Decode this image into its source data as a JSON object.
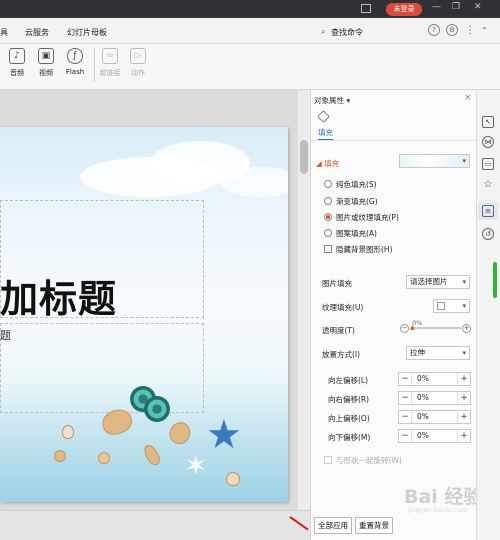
{
  "titlebar": {
    "login_badge": "未登录"
  },
  "menubar": {
    "items": [
      "具",
      "云服务",
      "幻灯片母板"
    ],
    "search_label": "查找命令"
  },
  "ribbon": {
    "buttons": [
      "音频",
      "视频",
      "Flash",
      "超链接",
      "动作"
    ],
    "icons": {
      "audio": "speaker-icon",
      "video": "film-icon",
      "flash": "flash-icon",
      "hyperlink": "link-icon",
      "action": "play-icon"
    }
  },
  "slide": {
    "title_text": "加标题",
    "subtitle_text": "题"
  },
  "panel": {
    "title": "对象属性",
    "title_caret": "▾",
    "close": "×",
    "tab_fill": "填充",
    "fill_section": "填充",
    "fill_options": [
      "纯色填充(S)",
      "渐变填充(G)",
      "图片或纹理填充(P)",
      "图案填充(A)"
    ],
    "fill_selected_index": 2,
    "hide_bg_graphics": "隐藏背景图形(H)",
    "picture_fill_label": "图片填充",
    "picture_fill_value": "请选择图片",
    "texture_fill_label": "纹理填充(U)",
    "transparency_label": "透明度(T)",
    "transparency_value": "0%",
    "transparency_minus": "−",
    "transparency_plus": "+",
    "placement_label": "放置方式(I)",
    "placement_value": "拉伸",
    "offsets": [
      {
        "label": "向左偏移(L)",
        "value": "0%"
      },
      {
        "label": "向右偏移(R)",
        "value": "0%"
      },
      {
        "label": "向上偏移(O)",
        "value": "0%"
      },
      {
        "label": "向下偏移(M)",
        "value": "0%"
      }
    ],
    "stepper_minus": "−",
    "stepper_plus": "+",
    "rotate_with_shape": "与形状一起旋转(W)",
    "apply_all_button": "全部应用",
    "reset_bg_button": "重置背景"
  },
  "watermark": {
    "text": "Bai 经验",
    "url": "jingyan.baidu.com"
  },
  "colors": {
    "accent": "#2b6fc6",
    "fill_orange": "#d4541f",
    "login_red": "#e04a3a",
    "starfish_blue": "#3b78c6"
  }
}
